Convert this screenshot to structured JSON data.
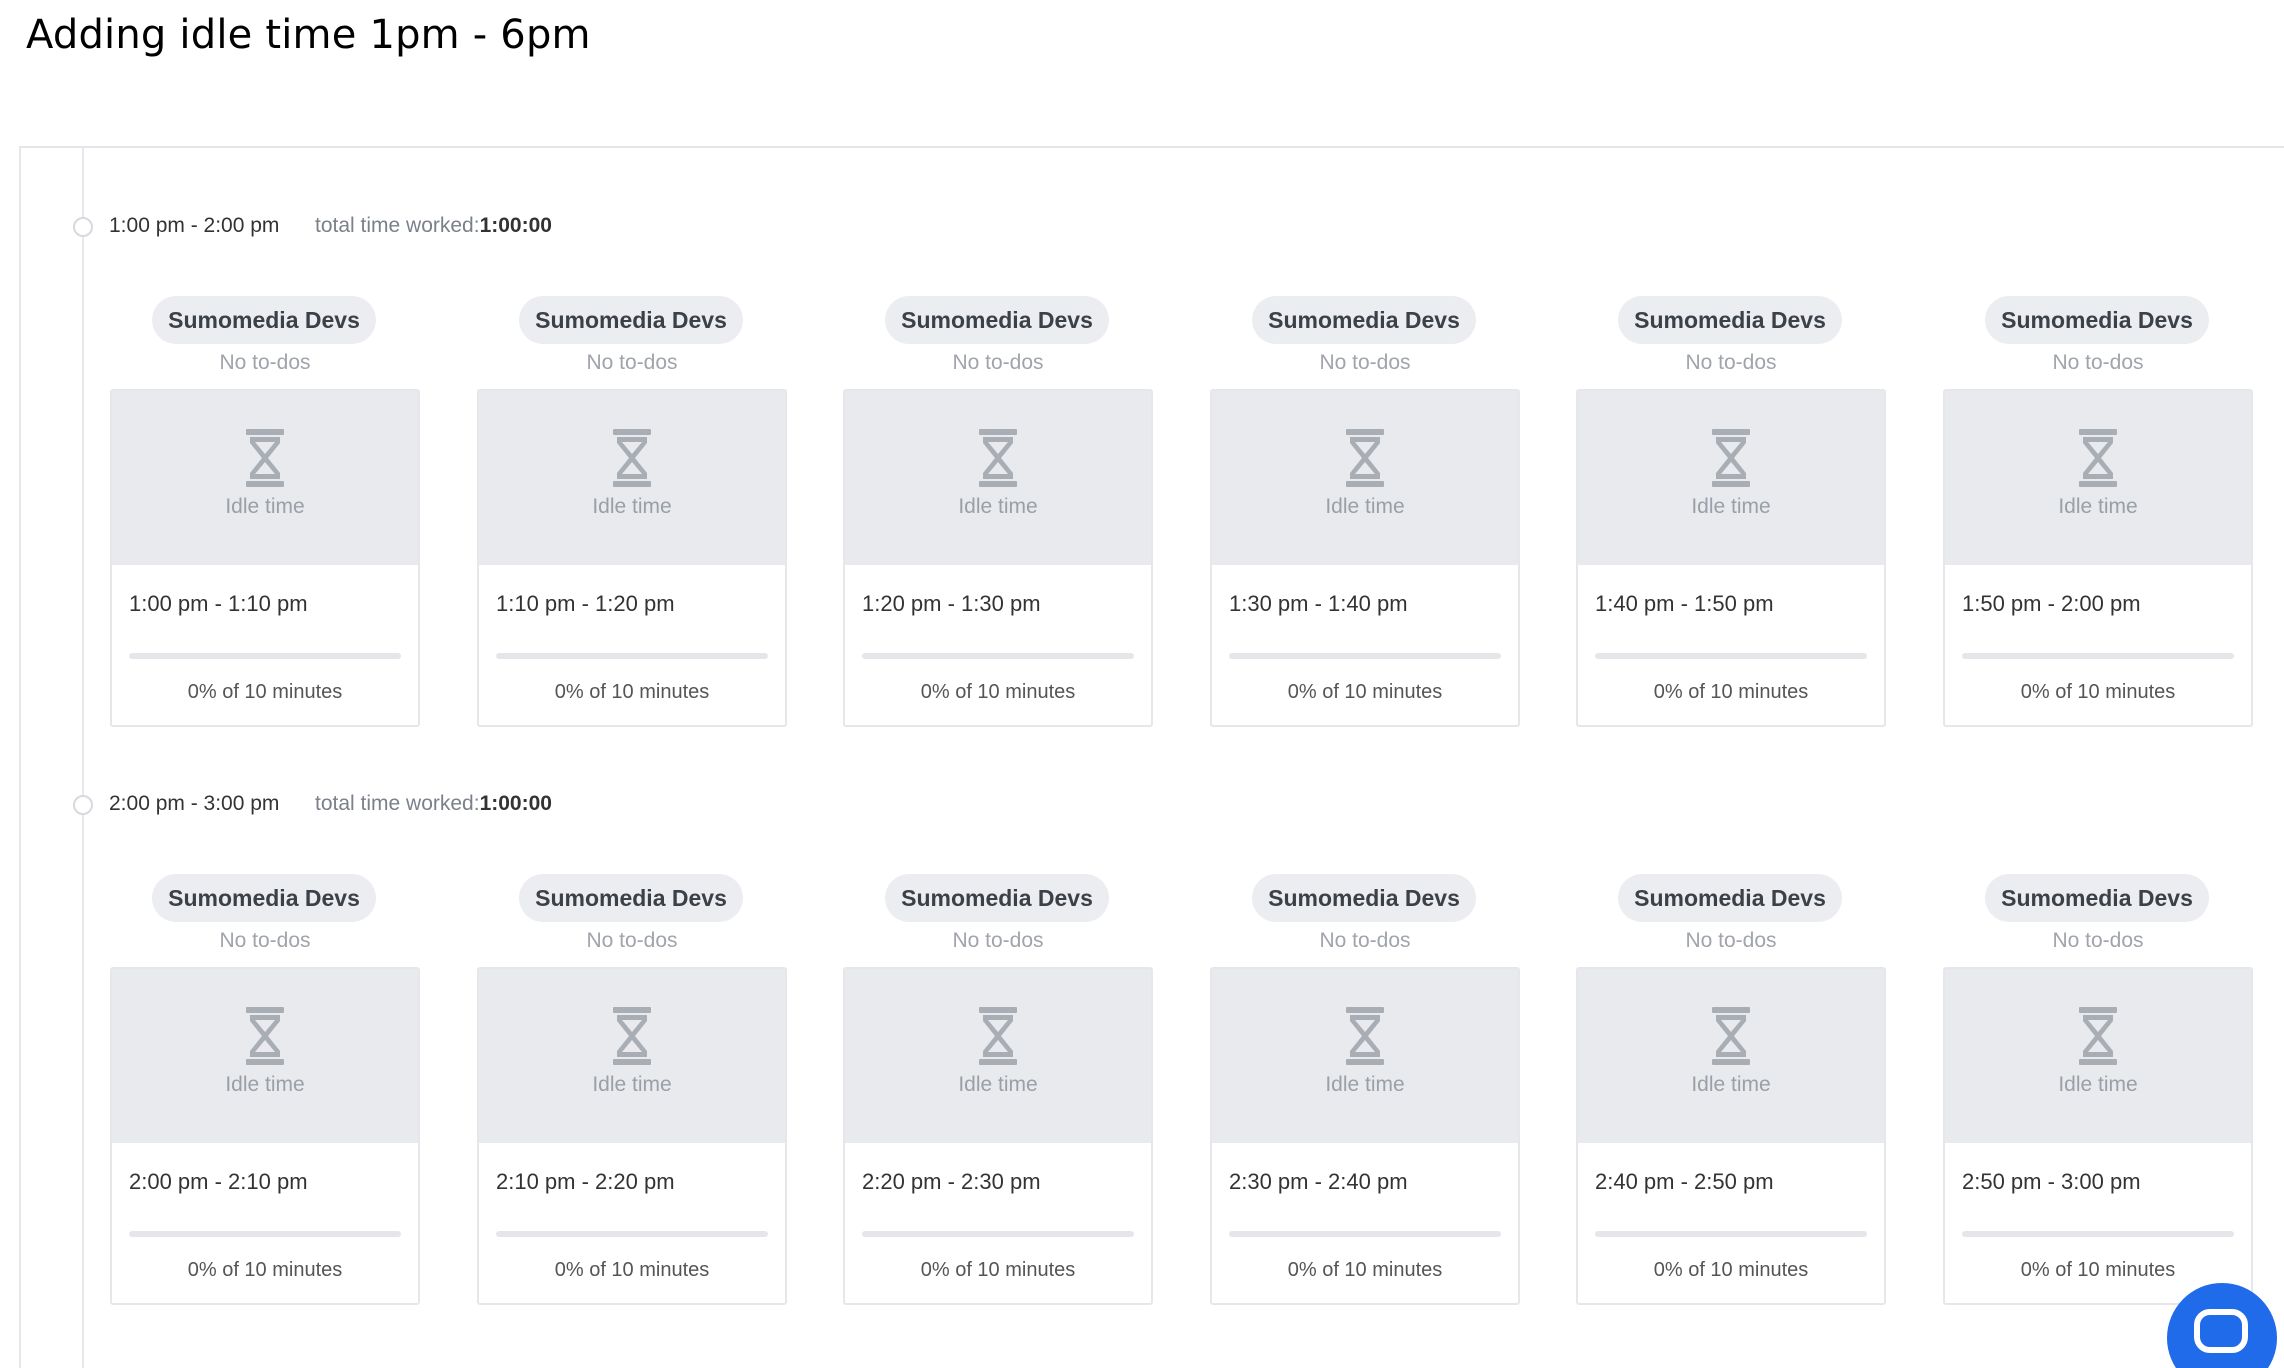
{
  "title": "Adding idle time 1pm - 6pm",
  "colors": {
    "accent": "#1f6bea",
    "idle_placeholder": "#e8eaed",
    "badge_bg": "#ebedf0"
  },
  "icons": {
    "idle": "hourglass-icon",
    "chat": "chat-bubble-icon"
  },
  "hours": [
    {
      "range": "1:00 pm - 2:00 pm",
      "total_label": "total time worked:",
      "total_value": "1:00:00",
      "slots": [
        {
          "project": "Sumomedia Devs",
          "todos": "No to-dos",
          "idle_label": "Idle time",
          "time": "1:00 pm - 1:10 pm",
          "activity_percent": 0,
          "activity": "0% of 10 minutes"
        },
        {
          "project": "Sumomedia Devs",
          "todos": "No to-dos",
          "idle_label": "Idle time",
          "time": "1:10 pm - 1:20 pm",
          "activity_percent": 0,
          "activity": "0% of 10 minutes"
        },
        {
          "project": "Sumomedia Devs",
          "todos": "No to-dos",
          "idle_label": "Idle time",
          "time": "1:20 pm - 1:30 pm",
          "activity_percent": 0,
          "activity": "0% of 10 minutes"
        },
        {
          "project": "Sumomedia Devs",
          "todos": "No to-dos",
          "idle_label": "Idle time",
          "time": "1:30 pm - 1:40 pm",
          "activity_percent": 0,
          "activity": "0% of 10 minutes"
        },
        {
          "project": "Sumomedia Devs",
          "todos": "No to-dos",
          "idle_label": "Idle time",
          "time": "1:40 pm - 1:50 pm",
          "activity_percent": 0,
          "activity": "0% of 10 minutes"
        },
        {
          "project": "Sumomedia Devs",
          "todos": "No to-dos",
          "idle_label": "Idle time",
          "time": "1:50 pm - 2:00 pm",
          "activity_percent": 0,
          "activity": "0% of 10 minutes"
        }
      ]
    },
    {
      "range": "2:00 pm - 3:00 pm",
      "total_label": "total time worked:",
      "total_value": "1:00:00",
      "slots": [
        {
          "project": "Sumomedia Devs",
          "todos": "No to-dos",
          "idle_label": "Idle time",
          "time": "2:00 pm - 2:10 pm",
          "activity_percent": 0,
          "activity": "0% of 10 minutes"
        },
        {
          "project": "Sumomedia Devs",
          "todos": "No to-dos",
          "idle_label": "Idle time",
          "time": "2:10 pm - 2:20 pm",
          "activity_percent": 0,
          "activity": "0% of 10 minutes"
        },
        {
          "project": "Sumomedia Devs",
          "todos": "No to-dos",
          "idle_label": "Idle time",
          "time": "2:20 pm - 2:30 pm",
          "activity_percent": 0,
          "activity": "0% of 10 minutes"
        },
        {
          "project": "Sumomedia Devs",
          "todos": "No to-dos",
          "idle_label": "Idle time",
          "time": "2:30 pm - 2:40 pm",
          "activity_percent": 0,
          "activity": "0% of 10 minutes"
        },
        {
          "project": "Sumomedia Devs",
          "todos": "No to-dos",
          "idle_label": "Idle time",
          "time": "2:40 pm - 2:50 pm",
          "activity_percent": 0,
          "activity": "0% of 10 minutes"
        },
        {
          "project": "Sumomedia Devs",
          "todos": "No to-dos",
          "idle_label": "Idle time",
          "time": "2:50 pm - 3:00 pm",
          "activity_percent": 0,
          "activity": "0% of 10 minutes"
        }
      ]
    }
  ]
}
